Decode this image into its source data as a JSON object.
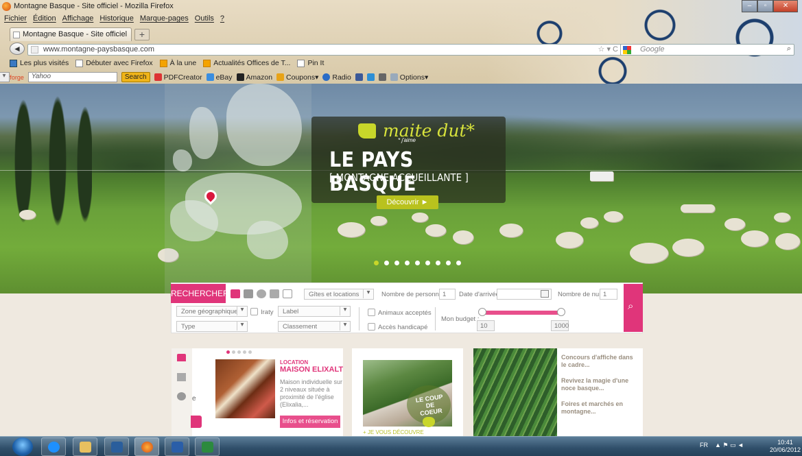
{
  "window": {
    "title": "Montagne Basque - Site officiel - Mozilla Firefox",
    "controls": [
      "–",
      "▫",
      "✕"
    ]
  },
  "menu": [
    "Fichier",
    "Édition",
    "Affichage",
    "Historique",
    "Marque-pages",
    "Outils",
    "?"
  ],
  "tab": {
    "label": "Montagne Basque - Site officiel",
    "new_tab": "+"
  },
  "nav": {
    "back": "◄",
    "url": "www.montagne-paysbasque.com",
    "url_controls": "☆ ▾ C",
    "search_placeholder": "Google",
    "search_icon": "⌕"
  },
  "bookmarks": [
    "Les plus visités",
    "Débuter avec Firefox",
    "À la une",
    "Actualités Offices de T...",
    "Pin It"
  ],
  "toolbar2": {
    "brand": "pdfforge",
    "yahoo_placeholder": "Yahoo",
    "search_btn": "Search",
    "items": [
      "PDFCreator",
      "eBay",
      "Amazon",
      "Coupons▾",
      "Radio"
    ],
    "options": "Options▾"
  },
  "hero": {
    "tagline": "maite dut*",
    "tagline_note": "* j'aime",
    "title": "LE PAYS BASQUE",
    "subtitle": "[ MONTAGNE ACCUEILLANTE ]",
    "cta": "Découvrir ►",
    "slides": 9,
    "active_slide": 1
  },
  "search": {
    "label": "RECHERCHER",
    "category": "Gîtes et locations",
    "persons_label": "Nombre de personnes",
    "persons_value": "1",
    "arrival_label": "Date d'arrivée",
    "nights_label": "Nombre de nuits",
    "nights_value": "1",
    "zone": "Zone géographique",
    "iraty": "Iraty",
    "label_select": "Label",
    "animals": "Animaux acceptés",
    "budget_label": "Mon budget :",
    "type": "Type",
    "classement": "Classement",
    "handicap": "Accès handicapé",
    "budget_min": "10",
    "budget_max": "1000"
  },
  "card1": {
    "kicker": "LOCATION",
    "title": "MAISON ELIXALTI",
    "desc": "Maison individuelle sur 2 niveaux située à proximité de l'église (Elixalia,...",
    "button": "Infos et réservation",
    "side_letter": "e"
  },
  "card2": {
    "stamp": "LE COUP DE COEUR",
    "footer": "+ JE VOUS DÉCOUVRE"
  },
  "card3": {
    "news": [
      "Concours d'affiche dans le cadre...",
      "Revivez la magie d'une noce basque...",
      "Foires et marchés en montagne..."
    ]
  },
  "taskbar": {
    "lang": "FR",
    "tray": "▲  ⚑  ▭  ◄",
    "time": "10:41",
    "date": "20/06/2012"
  },
  "colors": {
    "accent": "#e0357a",
    "lime": "#c8d62a"
  }
}
